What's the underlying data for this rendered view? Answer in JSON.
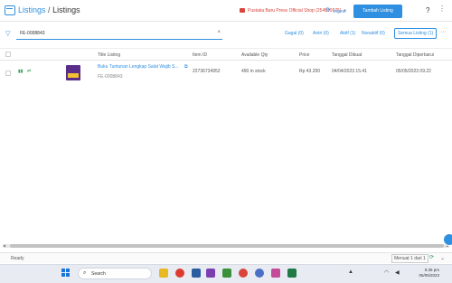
{
  "header": {
    "breadcrumb_root": "Listings",
    "breadcrumb_sep": "/",
    "breadcrumb_current": "Listings",
    "store_name": "Pustaka Baru Press Official Shop (254999975)",
    "sync_label": "Ingest",
    "add_button": "Tambah Listing",
    "help_label": "?"
  },
  "filter": {
    "search_value": "FE-0008843",
    "clear_glyph": "×",
    "tabs": [
      "Gagal (0)",
      "Antri (0)",
      "Aktif (1)",
      "Nonaktif (0)"
    ],
    "selected_tab": "Semua Listing (1)"
  },
  "table": {
    "columns": [
      "Title Listing",
      "Item ID",
      "Available Qty",
      "Price",
      "Tanggal Dibuat",
      "Tanggal Diperbarui"
    ],
    "rows": [
      {
        "title": "Buku Tuntunan Lengkap Salat Wajib S...",
        "sku": "FE-0008843",
        "item_id": "22736734952",
        "qty": "490 in stock",
        "price": "Rp 43.200",
        "created": "04/04/2023 15.41",
        "updated": "05/05/2023 09.22"
      }
    ]
  },
  "status": {
    "ready": "Ready",
    "page": "Menuat 1 dari 1"
  },
  "taskbar": {
    "search_placeholder": "Search",
    "time": "5:35 pm",
    "date": "05/05/2023"
  },
  "colors": {
    "accent": "#2f8fe0",
    "store": "#d9453a",
    "success": "#3aa05a"
  },
  "icons": {
    "logo": "listings-icon",
    "store": "shop-icon",
    "sync": "sync-icon",
    "filter": "funnel-icon",
    "refresh": "refresh-icon"
  }
}
